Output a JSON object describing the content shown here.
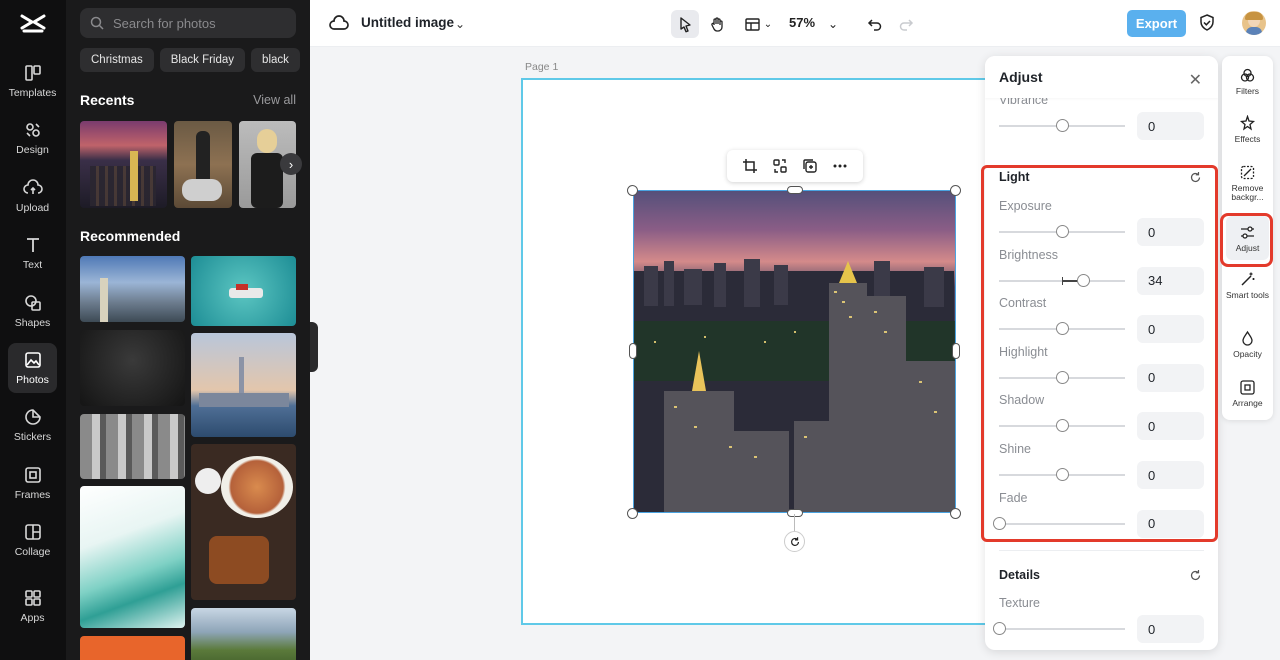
{
  "rail": {
    "items": [
      {
        "label": "Templates",
        "icon": "templates-icon"
      },
      {
        "label": "Design",
        "icon": "design-icon"
      },
      {
        "label": "Upload",
        "icon": "upload-icon"
      },
      {
        "label": "Text",
        "icon": "text-icon"
      },
      {
        "label": "Shapes",
        "icon": "shapes-icon"
      },
      {
        "label": "Photos",
        "icon": "photos-icon",
        "active": true
      },
      {
        "label": "Stickers",
        "icon": "stickers-icon"
      },
      {
        "label": "Frames",
        "icon": "frames-icon"
      },
      {
        "label": "Collage",
        "icon": "collage-icon"
      },
      {
        "label": "Apps",
        "icon": "apps-icon"
      }
    ]
  },
  "photos": {
    "search_placeholder": "Search for photos",
    "chips": [
      "Christmas",
      "Black Friday",
      "black"
    ],
    "recents_title": "Recents",
    "view_all": "View all",
    "recommended_title": "Recommended"
  },
  "topbar": {
    "doc_title": "Untitled image",
    "zoom": "57%",
    "export_label": "Export"
  },
  "canvas": {
    "page_label": "Page 1"
  },
  "adjust": {
    "title": "Adjust",
    "vibrance": {
      "label": "Vibrance",
      "value": "0"
    },
    "light_group": "Light",
    "light": [
      {
        "label": "Exposure",
        "value": "0",
        "level": 0
      },
      {
        "label": "Brightness",
        "value": "34",
        "level": 34
      },
      {
        "label": "Contrast",
        "value": "0",
        "level": 0
      },
      {
        "label": "Highlight",
        "value": "0",
        "level": 0
      },
      {
        "label": "Shadow",
        "value": "0",
        "level": 0
      },
      {
        "label": "Shine",
        "value": "0",
        "level": 0
      },
      {
        "label": "Fade",
        "value": "0",
        "level": 0
      }
    ],
    "details_group": "Details",
    "details": [
      {
        "label": "Texture",
        "value": "0"
      }
    ]
  },
  "tools": [
    {
      "label": "Filters",
      "icon": "filters-icon"
    },
    {
      "label": "Effects",
      "icon": "effects-icon"
    },
    {
      "label": "Remove backgr...",
      "icon": "remove-background-icon"
    },
    {
      "label": "Adjust",
      "icon": "adjust-icon",
      "active": true
    },
    {
      "label": "Smart tools",
      "icon": "smart-tools-icon"
    },
    {
      "label": "Opacity",
      "icon": "opacity-icon"
    },
    {
      "label": "Arrange",
      "icon": "arrange-icon"
    }
  ],
  "colors": {
    "accent": "#5ab0ee",
    "selection": "#4aa3e0",
    "annotation": "#e33a2b"
  }
}
